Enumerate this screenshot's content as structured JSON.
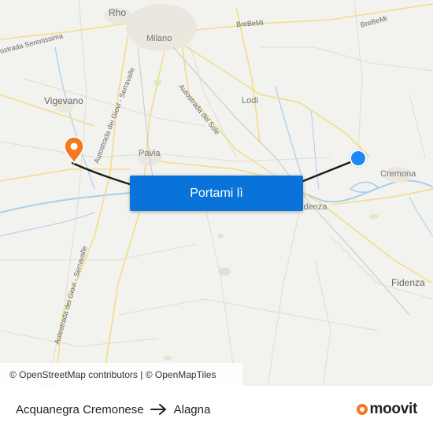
{
  "map": {
    "places": {
      "rho": "Rho",
      "milano": "Milano",
      "vigevano": "Vigevano",
      "lodi": "Lodi",
      "pavia": "Pavia",
      "cremona": "Cremona",
      "fidenza": "Fidenza",
      "fidenza_partial": "idenza"
    },
    "roads": {
      "brebemi_1": "BreBeMi",
      "brebemi_2": "BreBeMi",
      "serenissima": "ostrada Serenissima",
      "giovi_north": "Autostrada dei Giovi - Serravalle",
      "giovi_south": "Autostrada dei Giovi - Serravalle",
      "sole": "Autostrada del Sole"
    },
    "colors": {
      "route": "#1a1a1a",
      "origin": "#1e88f5",
      "destination": "#f5781e",
      "water": "#a8cfee"
    }
  },
  "cta": {
    "label": "Portami lì"
  },
  "attribution": "© OpenStreetMap contributors | © OpenMapTiles",
  "footer": {
    "origin": "Acquanegra Cremonese",
    "destination": "Alagna",
    "brand": "moovit"
  }
}
